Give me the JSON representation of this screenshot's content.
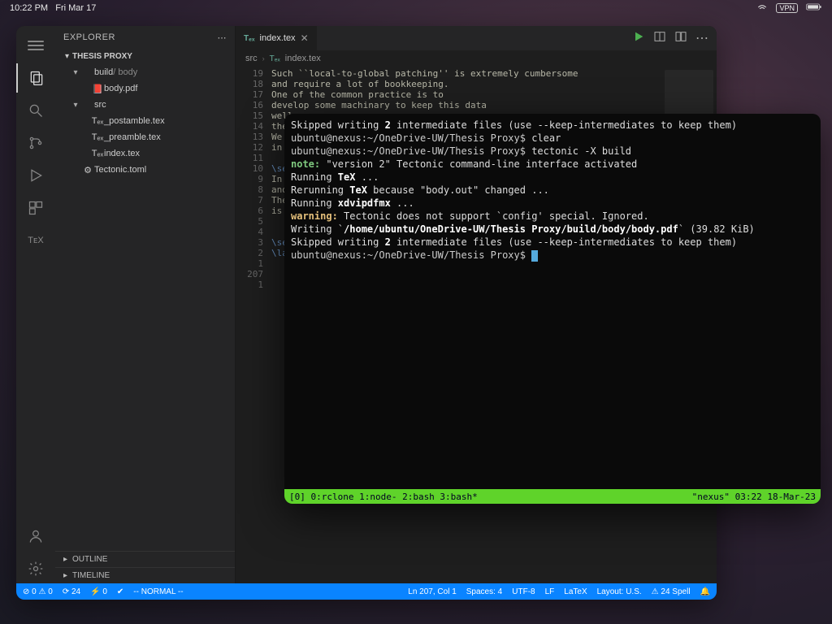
{
  "menubar": {
    "time": "10:22 PM",
    "date": "Fri Mar 17",
    "vpn": "VPN"
  },
  "sidebar": {
    "title": "EXPLORER",
    "project": "THESIS PROXY",
    "tree": [
      {
        "indent": 1,
        "chev": "▾",
        "icon": "",
        "label": "build",
        "suffix": " / body",
        "dim": false
      },
      {
        "indent": 2,
        "chev": "",
        "icon": "📕",
        "label": "body.pdf"
      },
      {
        "indent": 1,
        "chev": "▾",
        "icon": "",
        "label": "src"
      },
      {
        "indent": 2,
        "chev": "",
        "icon": "Tₑₓ",
        "label": "_postamble.tex"
      },
      {
        "indent": 2,
        "chev": "",
        "icon": "Tₑₓ",
        "label": "_preamble.tex"
      },
      {
        "indent": 2,
        "chev": "",
        "icon": "Tₑₓ",
        "label": "index.tex"
      },
      {
        "indent": 1,
        "chev": "",
        "icon": "⚙",
        "label": "Tectonic.toml"
      }
    ],
    "outline": "OUTLINE",
    "timeline": "TIMELINE"
  },
  "tabs": {
    "file": "index.tex",
    "breadcrumb": [
      "src",
      "index.tex"
    ]
  },
  "editor_actions": {
    "run": "run",
    "split": "split",
    "more": "more"
  },
  "gutter": [
    "19",
    "18",
    "17",
    "16",
    "15",
    "14",
    "13",
    "12",
    "11",
    "10",
    "9",
    "8",
    "7",
    "6",
    "5",
    "4",
    "3",
    "2",
    "1",
    "207",
    "1"
  ],
  "code_lines": [
    "Such ``local-to-global patching'' is extremely cumbersome",
    "and require a lot of bookkeeping.",
    "One of the common practice is to",
    "develop some machinary to keep this data",
    "well-o",
    "the i",
    "We wi",
    "in se",
    "",
    "\\sect",
    "In th",
    "and p",
    "The a",
    "is mo",
    "",
    "",
    "\\sect",
    "\\labe",
    "",
    ""
  ],
  "terminal": {
    "lines": [
      {
        "t": "Skipped writing ",
        "b": "2",
        "t2": " intermediate files (use --keep-intermediates to keep them)"
      },
      {
        "prompt": "ubuntu@nexus:~/OneDrive-UW/Thesis Proxy$",
        "cmd": " clear"
      },
      {
        "prompt": "ubuntu@nexus:~/OneDrive-UW/Thesis Proxy$",
        "cmd": " tectonic -X build"
      },
      {
        "note": "note:",
        "t": " \"version 2\" Tectonic command-line interface activated"
      },
      {
        "t": "Running ",
        "b": "TeX",
        "t2": " ..."
      },
      {
        "t": "Rerunning ",
        "b": "TeX",
        "t2": " because \"body.out\" changed ..."
      },
      {
        "t": "Running ",
        "b": "xdvipdfmx",
        "t2": " ..."
      },
      {
        "warn": "warning:",
        "t": " Tectonic does not support `config' special. Ignored."
      },
      {
        "t": "Writing `",
        "path": "/home/ubuntu/OneDrive-UW/Thesis Proxy/build/body/body.pdf",
        "t2": "` (39.82 KiB)"
      },
      {
        "t": "Skipped writing ",
        "b": "2",
        "t2": " intermediate files (use --keep-intermediates to keep them)"
      },
      {
        "prompt": "ubuntu@nexus:~/OneDrive-UW/Thesis Proxy$",
        "cursor": true
      }
    ],
    "status_left": "[0] 0:rclone  1:node-  2:bash  3:bash*",
    "status_right": "\"nexus\" 03:22 18-Mar-23"
  },
  "status": {
    "left": [
      "⊘ 0 ⚠ 0",
      "⟳ 24",
      "⚡ 0",
      "✔",
      "-- NORMAL --"
    ],
    "right": [
      "Ln 207, Col 1",
      "Spaces: 4",
      "UTF-8",
      "LF",
      "LaTeX",
      "Layout: U.S.",
      "⚠ 24 Spell",
      "🔔"
    ]
  }
}
